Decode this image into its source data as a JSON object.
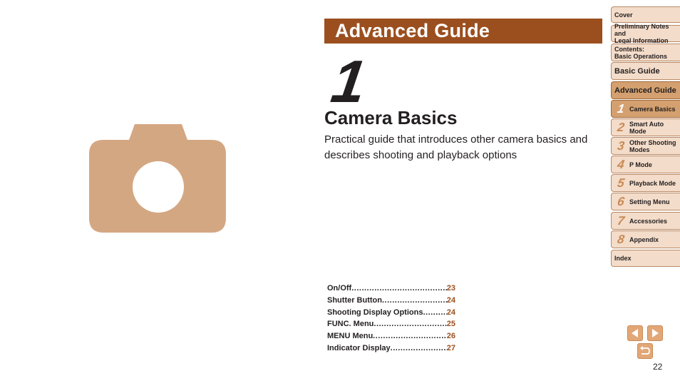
{
  "header": {
    "title": "Advanced Guide"
  },
  "chapter": {
    "number": "1",
    "title": "Camera Basics",
    "description": "Practical guide that introduces other camera basics and describes shooting and playback options"
  },
  "toc": [
    {
      "label": "On/Off",
      "page": "23"
    },
    {
      "label": "Shutter Button",
      "page": "24"
    },
    {
      "label": "Shooting Display Options",
      "page": "24"
    },
    {
      "label": "FUNC. Menu",
      "page": "25"
    },
    {
      "label": "MENU Menu",
      "page": "26"
    },
    {
      "label": "Indicator Display",
      "page": "27"
    }
  ],
  "sidebar": {
    "cover": "Cover",
    "prelim_line1": "Preliminary Notes and",
    "prelim_line2": "Legal Information",
    "contents_line1": "Contents:",
    "contents_line2": "Basic Operations",
    "basic_guide": "Basic Guide",
    "advanced_guide": "Advanced Guide",
    "chapters": [
      {
        "num": "1",
        "label": "Camera Basics",
        "active": true
      },
      {
        "num": "2",
        "label": "Smart Auto Mode",
        "active": false
      },
      {
        "num": "3",
        "label": "Other Shooting Modes",
        "active": false
      },
      {
        "num": "4",
        "label": "P Mode",
        "active": false
      },
      {
        "num": "5",
        "label": "Playback Mode",
        "active": false
      },
      {
        "num": "6",
        "label": "Setting Menu",
        "active": false
      },
      {
        "num": "7",
        "label": "Accessories",
        "active": false
      },
      {
        "num": "8",
        "label": "Appendix",
        "active": false
      }
    ],
    "index": "Index"
  },
  "navigation": {
    "prev_icon": "triangle-left-icon",
    "next_icon": "triangle-right-icon",
    "return_icon": "return-arrow-icon"
  },
  "page_number": "22",
  "colors": {
    "accent": "#9b4f1f",
    "camera_icon": "#d4a783",
    "tab_bg": "#f3dcc9",
    "tab_active_bg": "#d4a06f"
  }
}
